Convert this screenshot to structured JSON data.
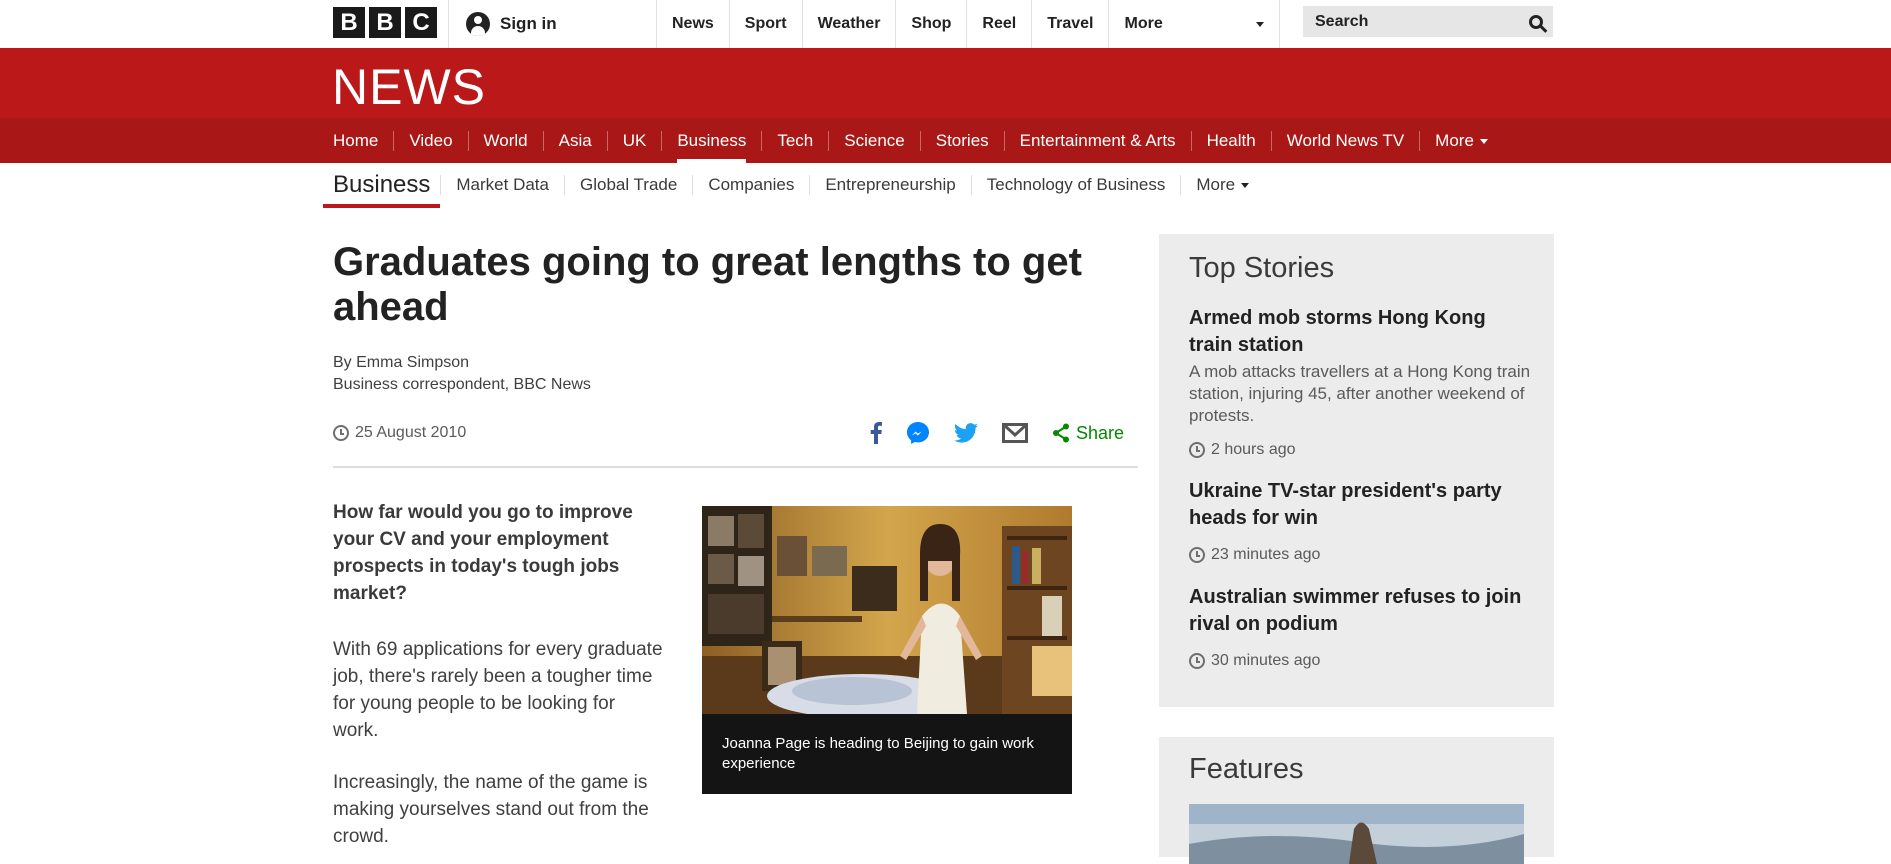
{
  "topbar": {
    "logo_letters": [
      "B",
      "B",
      "C"
    ],
    "signin_label": "Sign in",
    "nav": [
      "News",
      "Sport",
      "Weather",
      "Shop",
      "Reel",
      "Travel"
    ],
    "more_label": "More",
    "search_placeholder": "Search"
  },
  "brand": {
    "news_logo": "NEWS"
  },
  "main_nav": {
    "items": [
      "Home",
      "Video",
      "World",
      "Asia",
      "UK",
      "Business",
      "Tech",
      "Science",
      "Stories",
      "Entertainment & Arts",
      "Health",
      "World News TV"
    ],
    "active": "Business",
    "more_label": "More"
  },
  "sub_nav": {
    "section": "Business",
    "items": [
      "Market Data",
      "Global Trade",
      "Companies",
      "Entrepreneurship",
      "Technology of Business"
    ],
    "more_label": "More"
  },
  "article": {
    "headline": "Graduates going to great lengths to get ahead",
    "author": "By Emma Simpson",
    "author_role": "Business correspondent, BBC News",
    "date": "25 August 2010",
    "share_label": "Share",
    "share_icons": [
      "facebook-icon",
      "messenger-icon",
      "twitter-icon",
      "email-icon",
      "share-icon"
    ],
    "intro": "How far would you go to improve your CV and your employment prospects in today's tough jobs market?",
    "paragraphs": [
      "With 69 applications for every graduate job, there's rarely been a tougher time for young people to be looking for work.",
      "Increasingly, the name of the game is making yourselves stand out from the crowd."
    ],
    "image_caption": "Joanna Page is heading to Beijing to gain work experience"
  },
  "sidebar": {
    "top_stories_title": "Top Stories",
    "stories": [
      {
        "title": "Armed mob storms Hong Kong train station",
        "summary": "A mob attacks travellers at a Hong Kong train station, injuring 45, after another weekend of protests.",
        "time": "2 hours ago"
      },
      {
        "title": "Ukraine TV-star president's party heads for win",
        "summary": "",
        "time": "23 minutes ago"
      },
      {
        "title": "Australian swimmer refuses to join rival on podium",
        "summary": "",
        "time": "30 minutes ago"
      }
    ],
    "features_title": "Features"
  },
  "colors": {
    "bbc_red": "#bb1919",
    "nav_red": "#a91717",
    "share_green": "#008a00",
    "sidebar_bg": "#ececec"
  }
}
